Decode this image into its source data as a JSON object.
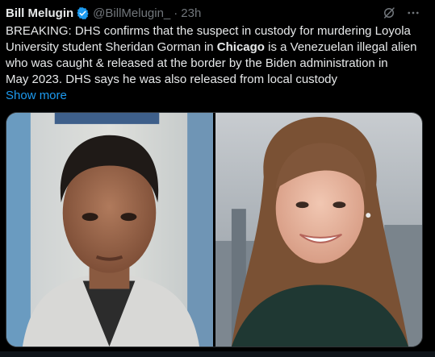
{
  "author": {
    "display_name": "Bill Melugin",
    "handle": "@BillMelugin_",
    "separator": "·",
    "timestamp": "23h"
  },
  "icons": {
    "verified": "verified-badge-icon",
    "grok": "grok-icon",
    "more": "more-options-icon"
  },
  "body": {
    "line1": "BREAKING: DHS confirms that the suspect in custody for murdering Loyola",
    "line2_pre": "University student Sheridan Gorman in ",
    "line2_bold": "Chicago",
    "line2_post": " is a Venezuelan illegal alien",
    "line3": "who was caught & released at the border by the Biden administration in",
    "line4": "May 2023. DHS says he was also released from local custody"
  },
  "show_more": "Show more",
  "colors": {
    "background": "#000000",
    "text": "#e7e9ea",
    "muted": "#71767b",
    "link": "#1d9bf0",
    "border": "#2f3336"
  }
}
